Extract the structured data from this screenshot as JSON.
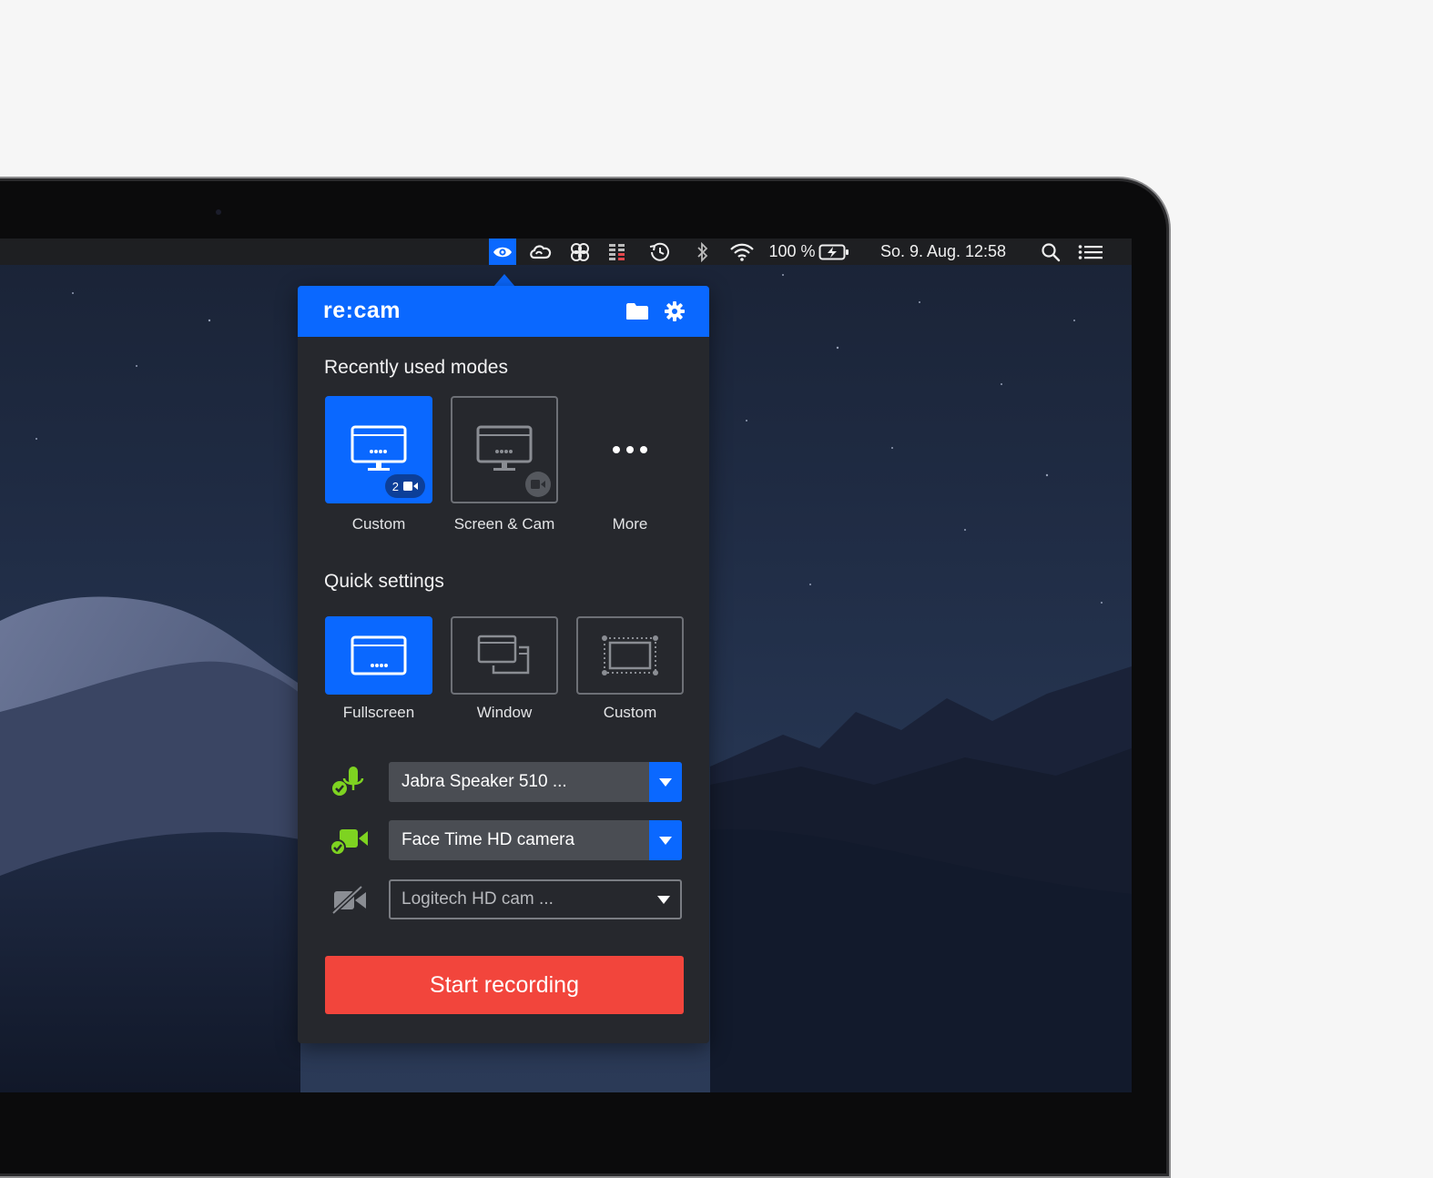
{
  "menubar": {
    "battery_percent": "100 %",
    "datetime": "So. 9. Aug.  12:58",
    "icons": [
      "recam-eye-icon",
      "creative-cloud-icon",
      "scanner-icon",
      "istat-icon",
      "time-machine-icon",
      "bluetooth-icon",
      "wifi-icon",
      "battery-icon",
      "spotlight-icon",
      "notification-center-icon"
    ]
  },
  "popover": {
    "brand": "re:cam",
    "header_icons": [
      "folder-icon",
      "gear-icon"
    ],
    "recent_title": "Recently used modes",
    "recent_modes": [
      {
        "label": "Custom",
        "badge_count": "2",
        "active": true
      },
      {
        "label": "Screen & Cam",
        "active": false
      },
      {
        "label": "More",
        "active": false
      }
    ],
    "quick_title": "Quick settings",
    "quick_modes": [
      {
        "label": "Fullscreen",
        "active": true
      },
      {
        "label": "Window",
        "active": false
      },
      {
        "label": "Custom",
        "active": false
      }
    ],
    "devices": {
      "microphone": "Jabra Speaker 510 ...",
      "camera": "Face Time HD camera",
      "second_camera": "Logitech HD cam ..."
    },
    "start_label": "Start recording"
  },
  "colors": {
    "accent": "#0a68ff",
    "record": "#f2453c",
    "ok_green": "#7ed321",
    "panel": "#26282d"
  }
}
